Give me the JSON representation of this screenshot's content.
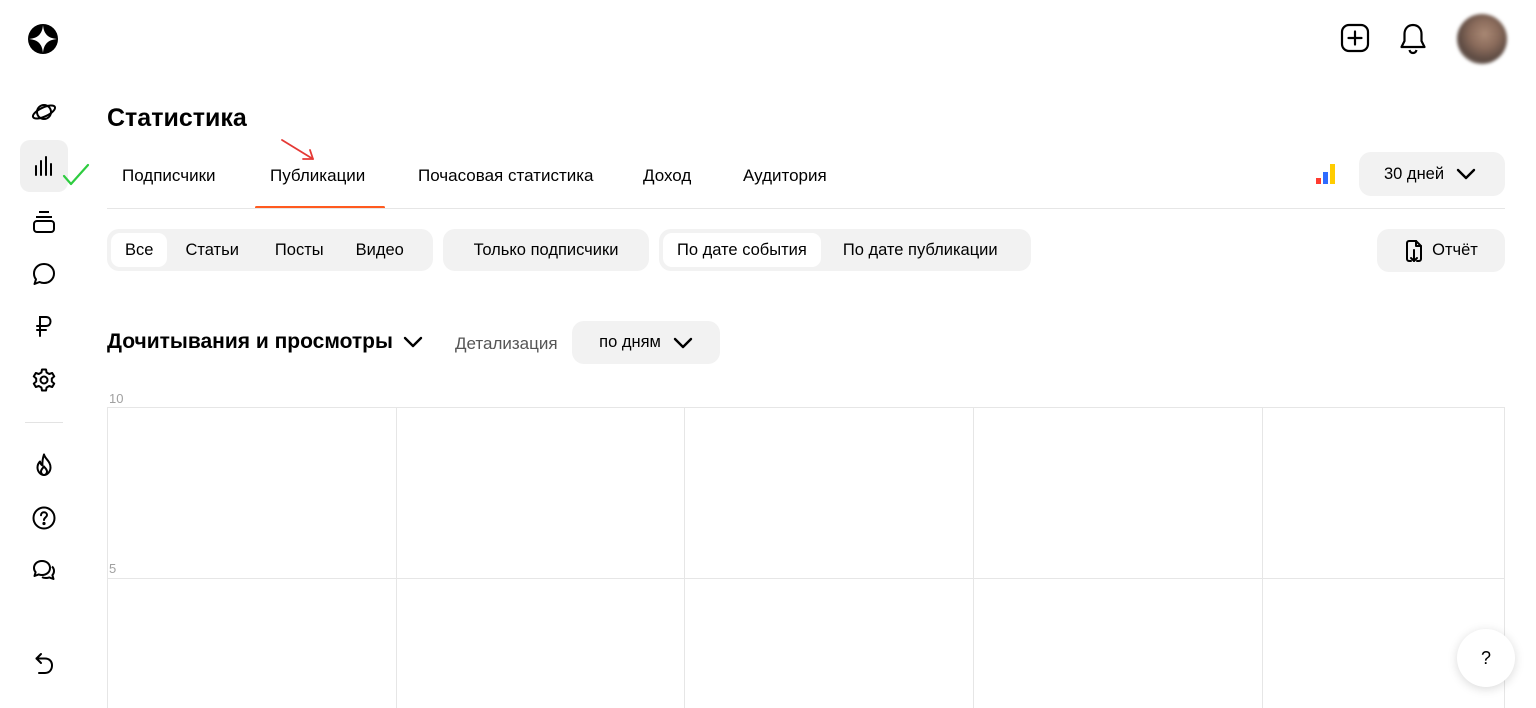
{
  "page": {
    "title": "Статистика"
  },
  "tabs": [
    {
      "label": "Подписчики"
    },
    {
      "label": "Публикации",
      "active": true
    },
    {
      "label": "Почасовая статистика"
    },
    {
      "label": "Доход"
    },
    {
      "label": "Аудитория"
    }
  ],
  "period": {
    "label": "30 дней"
  },
  "filters": {
    "content_type": [
      "Все",
      "Статьи",
      "Посты",
      "Видео"
    ],
    "subscribers_only": "Только подписчики",
    "date_mode": [
      "По дате события",
      "По дате публикации"
    ]
  },
  "report_button": {
    "label": "Отчёт"
  },
  "metric": {
    "label": "Дочитывания и просмотры"
  },
  "detail": {
    "label": "Детализация",
    "value": "по дням"
  },
  "chart_data": {
    "type": "line",
    "title": "",
    "xlabel": "",
    "ylabel": "",
    "y_ticks": [
      "10",
      "5"
    ],
    "ylim": [
      0,
      10
    ],
    "series": [],
    "grid": true
  },
  "help": {
    "label": "?"
  },
  "colors": {
    "accent": "#fc3f1d",
    "tab_underline": "#ff5a1f",
    "check": "#2ecc40",
    "arrow": "#e53935",
    "pill_bg": "#f2f2f2",
    "grid": "#e6e6e6"
  },
  "icons": {
    "logo": "zen-star-logo-icon",
    "sidebar": [
      "planet-icon",
      "bar-chart-icon",
      "stack-icon",
      "chat-bubble-icon",
      "ruble-icon",
      "gear-icon",
      "flame-icon",
      "help-circle-icon",
      "dialogs-icon",
      "back-arrow-icon"
    ],
    "header": [
      "add-square-icon",
      "bell-icon",
      "avatar"
    ]
  }
}
